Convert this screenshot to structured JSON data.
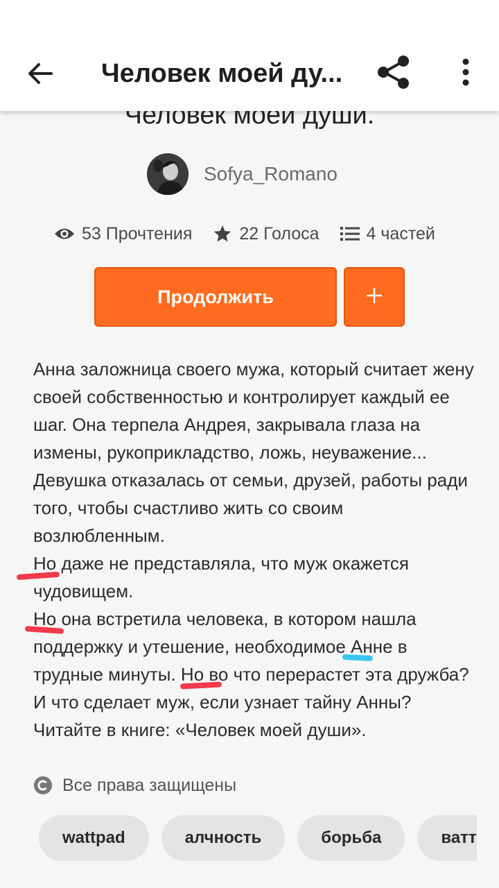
{
  "topbar": {
    "title": "Человек моей ду..."
  },
  "story": {
    "title": "Человек моей души.",
    "author": "Sofya_Romano",
    "stats": {
      "reads": "53 Прочтения",
      "votes": "22 Голоса",
      "parts": "4 частей"
    },
    "continue_label": "Продолжить",
    "add_label": "+"
  },
  "description": [
    "Анна заложница своего мужа, который считает жену своей собственностью и контролирует каждый ее шаг. Она терпела Андрея, закрывала глаза на измены, рукоприкладство, ложь, неуважение... Девушка отказалась от семьи, друзей, работы ради того, чтобы счастливо жить со своим возлюбленным.",
    "Но даже не представляла, что муж окажется чудовищем.",
    " Но она встретила человека, в котором нашла поддержку и утешение, необходимое Анне в трудные минуты. Но во что перерастет эта дружба? И что сделает муж, если узнает тайну Анны? Читайте в книге: «Человек моей души»."
  ],
  "rights": "Все права защищены",
  "tags": [
    "wattpad",
    "алчность",
    "борьба",
    "ваттпад"
  ],
  "icons": {
    "back": "arrow-left-icon",
    "share": "share-icon",
    "more": "more-vertical-icon",
    "reads": "eye-icon",
    "votes": "star-icon",
    "parts": "list-icon",
    "rights": "copyright-icon"
  },
  "colors": {
    "accent": "#ff6b1f",
    "underline_red": "#f23a4a",
    "underline_blue": "#38c4f0"
  }
}
